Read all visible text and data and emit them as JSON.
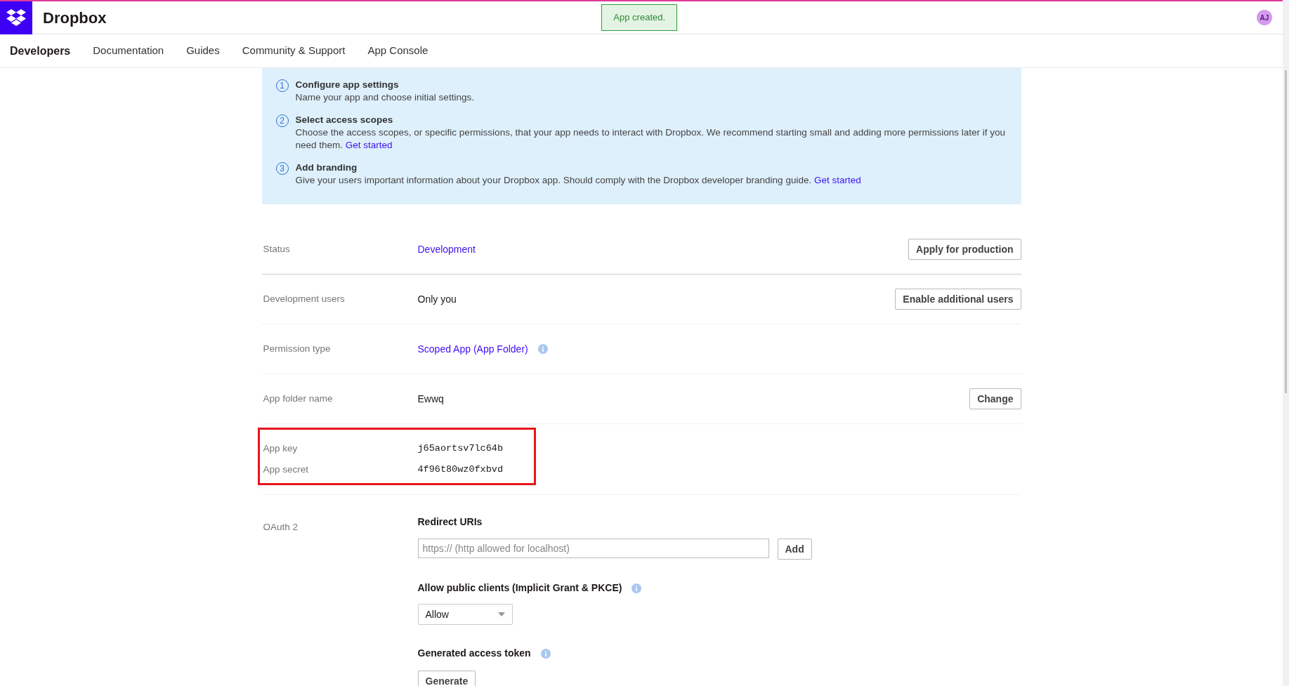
{
  "header": {
    "brand": "Dropbox",
    "toast": "App created.",
    "avatar": "AJ"
  },
  "nav": [
    {
      "label": "Developers",
      "selected": true
    },
    {
      "label": "Documentation",
      "selected": false
    },
    {
      "label": "Guides",
      "selected": false
    },
    {
      "label": "Community & Support",
      "selected": false
    },
    {
      "label": "App Console",
      "selected": false
    }
  ],
  "steps": [
    {
      "number": "1",
      "title": "Configure app settings",
      "text": "Name your app and choose initial settings."
    },
    {
      "number": "2",
      "title": "Select access scopes",
      "text": "Choose the access scopes, or specific permissions, that your app needs to interact with Dropbox. We recommend starting small and adding more permissions later if you need them.",
      "link": "Get started"
    },
    {
      "number": "3",
      "title": "Add branding",
      "text": "Give your users important information about your Dropbox app. Should comply with the Dropbox developer branding guide.",
      "link": "Get started"
    }
  ],
  "settings": [
    {
      "label": "Status",
      "value": "Development",
      "kind": "link",
      "button": "Apply for production"
    },
    {
      "label": "Development users",
      "value": "Only you",
      "kind": "plain",
      "button": "Enable additional users"
    },
    {
      "label": "Permission type",
      "value": "Scoped App (App Folder)",
      "kind": "link",
      "info": true
    },
    {
      "label": "App folder name",
      "value": "Ewwq",
      "kind": "plain",
      "button": "Change"
    }
  ],
  "credentials": {
    "highlighted": true,
    "items": [
      {
        "label": "App key",
        "value": "j65aortsv7lc64b"
      },
      {
        "label": "App secret",
        "value": "4f96t80wz0fxbvd"
      }
    ]
  },
  "oauth": {
    "label": "OAuth 2",
    "redirect_title": "Redirect URIs",
    "redirect_placeholder": "https:// (http allowed for localhost)",
    "add_button": "Add",
    "public_title": "Allow public clients (Implicit Grant & PKCE)",
    "public_value": "Allow",
    "token_title": "Generated access token",
    "generate_button": "Generate"
  }
}
